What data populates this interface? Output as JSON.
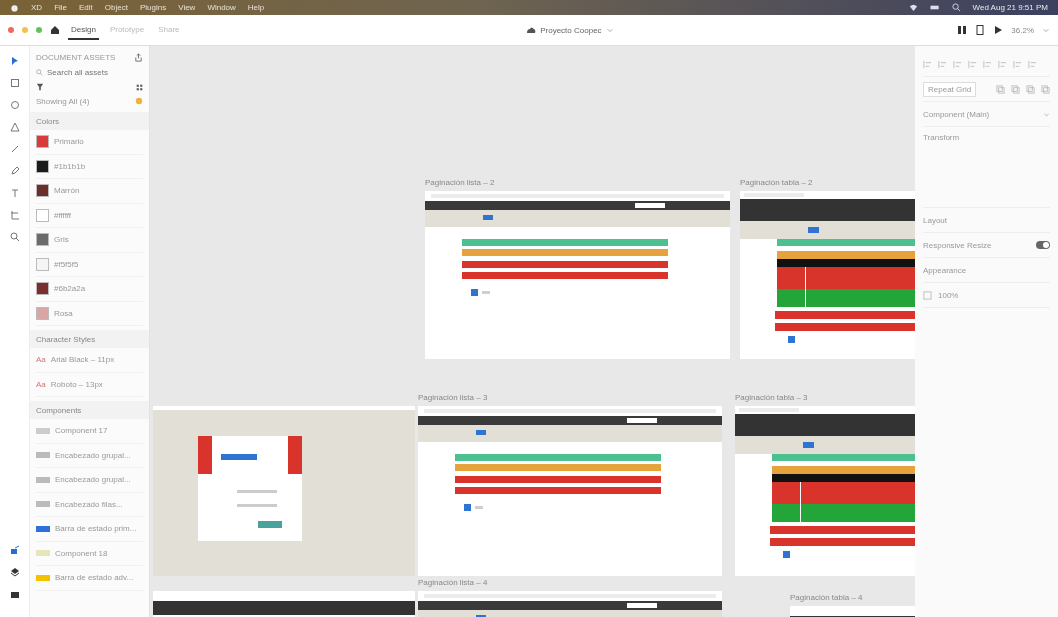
{
  "menu_bar": {
    "items": [
      "XD",
      "File",
      "Edit",
      "Object",
      "Plugins",
      "View",
      "Window",
      "Help"
    ],
    "clock": "Wed Aug 21 9:51 PM"
  },
  "toolbar": {
    "tabs": [
      {
        "label": "Design",
        "selected": true
      },
      {
        "label": "Prototype",
        "selected": false
      },
      {
        "label": "Share",
        "selected": false
      }
    ],
    "document_title": "Proyecto Coopec",
    "zoom": "36.2%"
  },
  "assets": {
    "title": "DOCUMENT ASSETS",
    "search": {
      "placeholder": "Search all assets"
    },
    "showing": "Showing All (4)",
    "colors_title": "Colors",
    "colors": [
      {
        "label": "Primario",
        "color": "#d93a3a"
      },
      {
        "label": "#1b1b1b",
        "color": "#1b1b1b"
      },
      {
        "label": "Marrón",
        "color": "#6e2d2d"
      },
      {
        "label": "#ffffff",
        "color": "#ffffff"
      },
      {
        "label": "Gris",
        "color": "#6b6b6b"
      },
      {
        "label": "#f5f5f5",
        "color": "#f5f5f5"
      },
      {
        "label": "#6b2a2a",
        "color": "#7a2e2e"
      },
      {
        "label": "Rosa",
        "color": "#d9a5a5"
      }
    ],
    "character_styles_title": "Character Styles",
    "character_styles": [
      {
        "sample": "Aa",
        "label": "Arial Black – 11px"
      },
      {
        "sample": "Aa",
        "label": "Roboto – 13px"
      }
    ],
    "components_title": "Components",
    "components": [
      {
        "label": "Component 17",
        "color": "#cccccc"
      },
      {
        "label": "Encabezado grupal...",
        "color": "#bbbbbb"
      },
      {
        "label": "Encabezado grupal...",
        "color": "#bbbbbb"
      },
      {
        "label": "Encabezado filas...",
        "color": "#bbbbbb"
      },
      {
        "label": "Barra de estado prim...",
        "color": "#2f6fdc"
      },
      {
        "label": "Component 18",
        "color": "#e6e6b8"
      },
      {
        "label": "Barra de estado adv...",
        "color": "#f2c200"
      }
    ]
  },
  "properties": {
    "repeat_grid": "Repeat Grid",
    "component": "Component (Main)",
    "transform": "Transform",
    "layout": "Layout",
    "responsive_resize": {
      "label": "Responsive Resize",
      "on": true
    },
    "appearance": "Appearance",
    "opacity": "100%"
  },
  "artboards": [
    {
      "title": "Paginación lista – 2",
      "kind": "wide"
    },
    {
      "title": "Paginación tabla – 2",
      "kind": "narrow"
    },
    {
      "kind": "login"
    },
    {
      "title": "Paginación lista – 3",
      "kind": "wide"
    },
    {
      "title": "Paginación tabla – 3",
      "kind": "narrow"
    },
    {
      "kind": "strip"
    },
    {
      "title": "Paginación lista – 4",
      "kind": "wide"
    },
    {
      "title": "Paginación tabla – 4",
      "kind": "strip"
    }
  ]
}
